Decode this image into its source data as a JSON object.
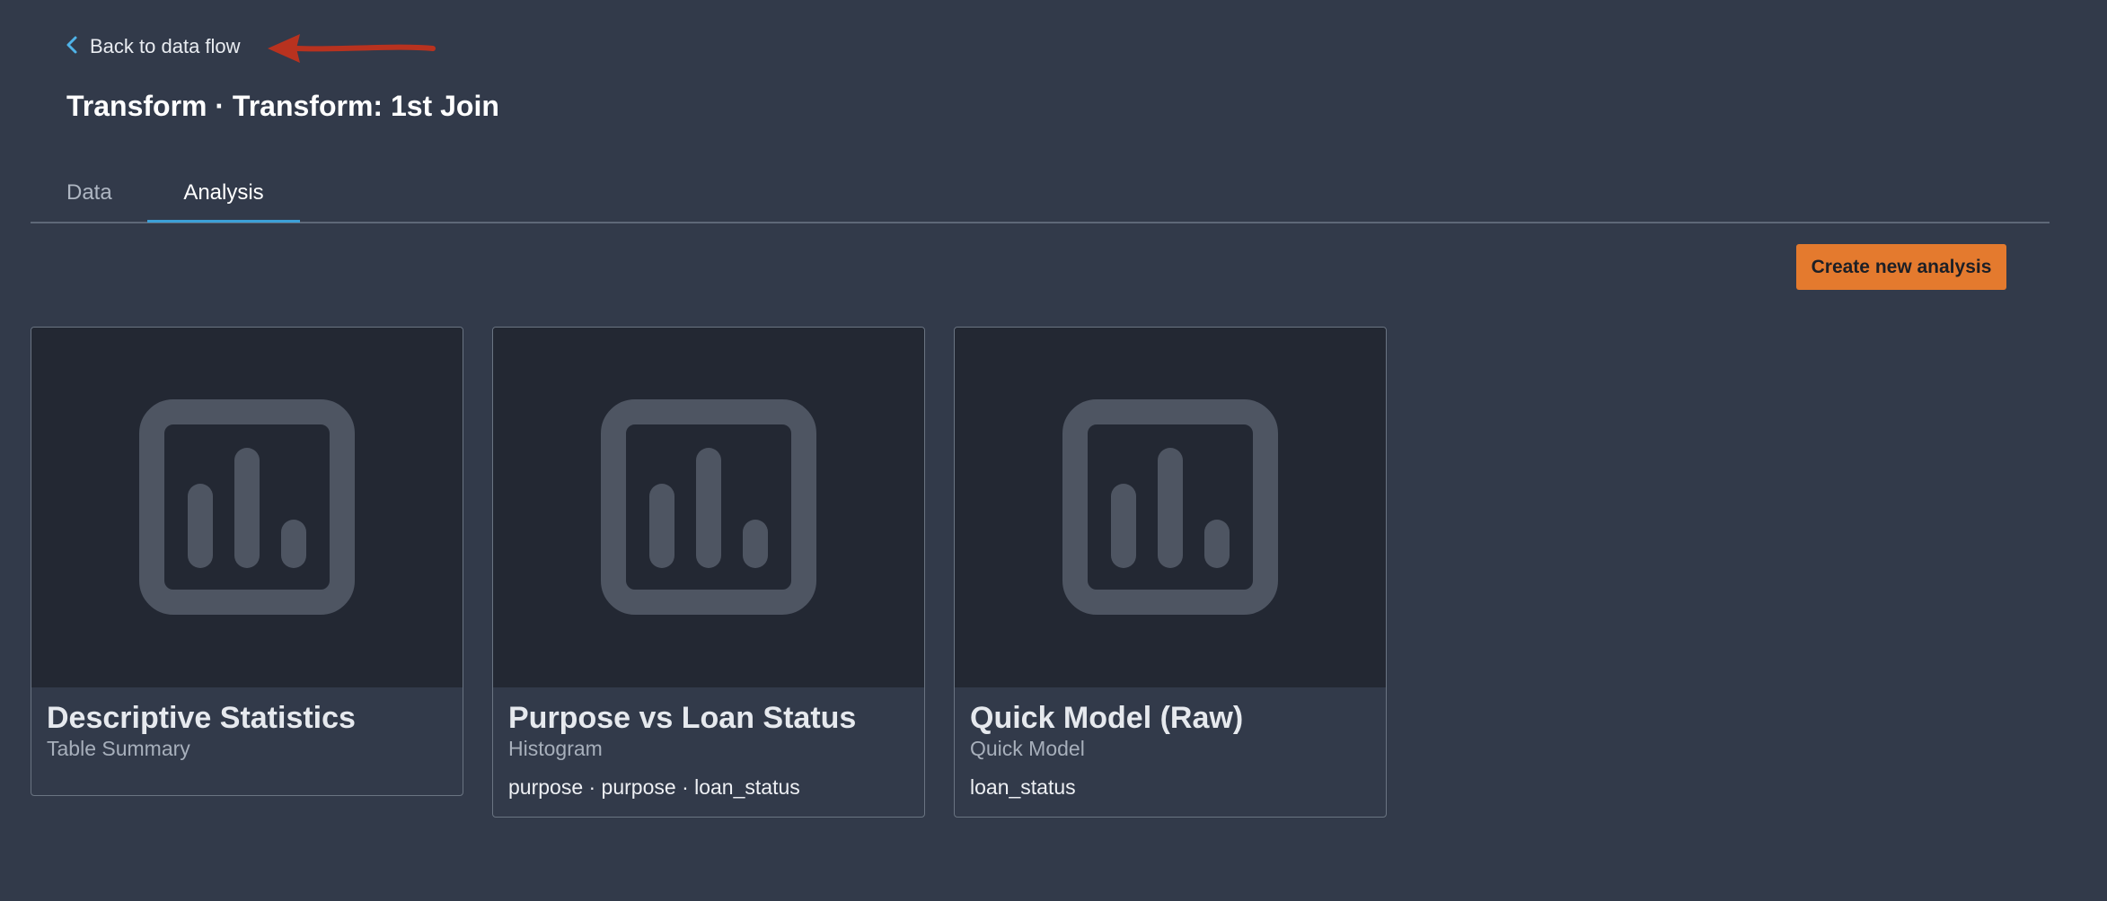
{
  "back": {
    "label": "Back to data flow",
    "icon": "chevron-left-icon",
    "icon_color": "#4fb3e8"
  },
  "annotation": {
    "icon": "red-arrow-annotation",
    "color": "#b8321f"
  },
  "page": {
    "title": "Transform · Transform: 1st Join"
  },
  "tabs": [
    {
      "label": "Data",
      "selected": false
    },
    {
      "label": "Analysis",
      "selected": true
    }
  ],
  "actions": {
    "create_label": "Create new analysis",
    "create_color": "#e47a2e"
  },
  "cards": [
    {
      "title": "Descriptive Statistics",
      "type": "Table Summary",
      "columns": "",
      "icon": "bar-chart-icon"
    },
    {
      "title": "Purpose vs Loan Status",
      "type": "Histogram",
      "columns": "purpose · purpose · loan_status",
      "icon": "bar-chart-icon"
    },
    {
      "title": "Quick Model (Raw)",
      "type": "Quick Model",
      "columns": "loan_status",
      "icon": "bar-chart-icon"
    }
  ]
}
